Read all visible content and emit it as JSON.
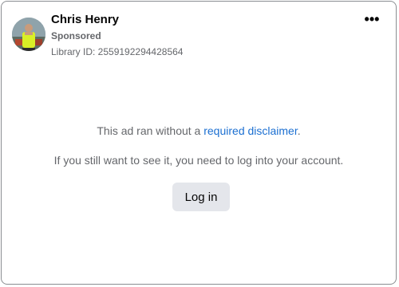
{
  "ad": {
    "advertiser_name": "Chris Henry",
    "sponsored_label": "Sponsored",
    "library_id": "Library ID: 2559192294428564",
    "more_icon": "more-horizontal-icon"
  },
  "notice": {
    "line1_prefix": "This ad ran without a ",
    "line1_link": "required disclaimer",
    "line1_suffix": ".",
    "line2": "If you still want to see it, you need to log into your account."
  },
  "actions": {
    "login_label": "Log in"
  },
  "colors": {
    "link": "#1b6fd1",
    "button_bg": "#e4e6eb",
    "muted_text": "#65676b",
    "border": "#8a8d91"
  }
}
